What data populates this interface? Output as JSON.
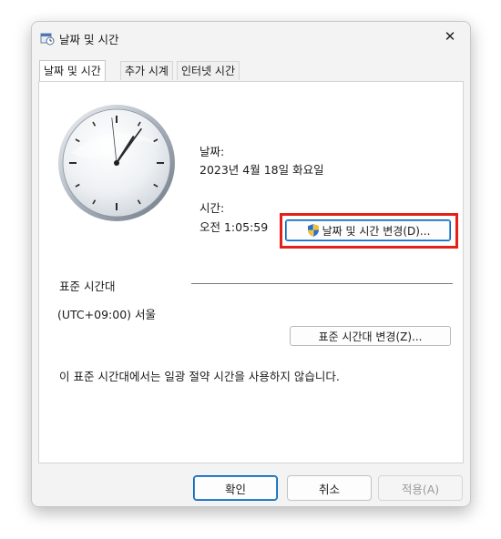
{
  "window": {
    "title": "날짜 및 시간",
    "close_glyph": "✕"
  },
  "tabs": [
    {
      "label": "날짜 및 시간",
      "active": true
    },
    {
      "label": "추가 시계",
      "active": false
    },
    {
      "label": "인터넷 시간",
      "active": false
    }
  ],
  "datetime": {
    "date_label": "날짜:",
    "date_value": "2023년 4월 18일 화요일",
    "time_label": "시간:",
    "time_value": "오전 1:05:59",
    "change_button": "날짜 및 시간 변경(D)..."
  },
  "timezone": {
    "section_label": "표준 시간대",
    "value": "(UTC+09:00) 서울",
    "change_button": "표준 시간대 변경(Z)...",
    "dst_note": "이 표준 시간대에서는 일광 절약 시간을 사용하지 않습니다."
  },
  "footer": {
    "ok": "확인",
    "cancel": "취소",
    "apply": "적용(A)"
  },
  "clock": {
    "hour": 1,
    "minute": 5,
    "second": 59
  },
  "colors": {
    "accent": "#0067c0",
    "highlight": "#e32119"
  },
  "icons": {
    "title": "calendar-clock-icon",
    "shield": "uac-shield-icon"
  }
}
